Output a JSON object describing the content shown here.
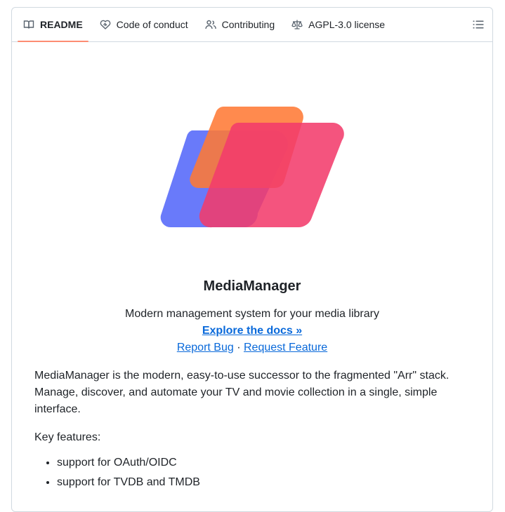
{
  "tabs": [
    {
      "label": "README",
      "icon": "book-icon",
      "active": true
    },
    {
      "label": "Code of conduct",
      "icon": "code-of-conduct-icon",
      "active": false
    },
    {
      "label": "Contributing",
      "icon": "people-icon",
      "active": false
    },
    {
      "label": "AGPL-3.0 license",
      "icon": "law-icon",
      "active": false
    }
  ],
  "toc_icon": "list-unordered-icon",
  "readme": {
    "logo_icon": "mediamanager-logo",
    "title": "MediaManager",
    "tagline": "Modern management system for your media library",
    "docs_link": "Explore the docs »",
    "report_bug": "Report Bug",
    "separator": "·",
    "request_feature": "Request Feature",
    "description": "MediaManager is the modern, easy-to-use successor to the fragmented \"Arr\" stack. Manage, discover, and automate your TV and movie collection in a single, simple interface.",
    "key_features_label": "Key features:",
    "features": [
      "support for OAuth/OIDC",
      "support for TVDB and TMDB"
    ]
  },
  "colors": {
    "accent_underline": "#fd8c73",
    "link": "#0969da",
    "logo_blue": "#5c6ffa",
    "logo_orange": "#ff7a35",
    "logo_pink": "#f23c6c"
  }
}
